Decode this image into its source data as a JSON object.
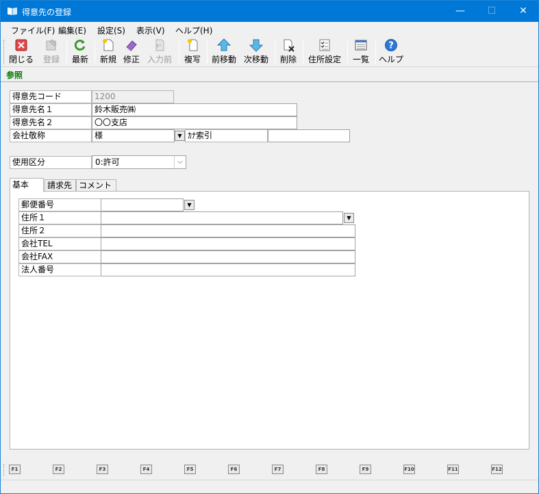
{
  "window": {
    "title": "得意先の登録",
    "minimize": "—",
    "maximize": "☐",
    "close": "✕"
  },
  "menu": [
    "ファイル(F)",
    "編集(E)",
    "設定(S)",
    "表示(V)",
    "ヘルプ(H)"
  ],
  "toolbar": {
    "close": "閉じる",
    "register": "登録",
    "refresh": "最新",
    "new": "新規",
    "edit": "修正",
    "prev_input": "入力前",
    "copy": "複写",
    "prev_move": "前移動",
    "next_move": "次移動",
    "delete": "削除",
    "address_settings": "住所設定",
    "list": "一覧",
    "help": "ヘルプ"
  },
  "ref_tab": "参照",
  "form": {
    "code_label": "得意先コード",
    "code_value": "1200",
    "name1_label": "得意先名１",
    "name1_value": "鈴木販売㈱",
    "name2_label": "得意先名２",
    "name2_value": "〇〇支店",
    "honorific_label": "会社敬称",
    "honorific_value": "様",
    "kana_label": "ｶﾅ索引",
    "kana_value": "",
    "usage_label": "使用区分",
    "usage_value": "0:許可"
  },
  "tabs": [
    "基本",
    "請求先",
    "コメント"
  ],
  "basic": {
    "postal_label": "郵便番号",
    "postal_value": "",
    "address1_label": "住所１",
    "address1_value": "",
    "address2_label": "住所２",
    "address2_value": "",
    "tel_label": "会社TEL",
    "tel_value": "",
    "fax_label": "会社FAX",
    "fax_value": "",
    "corp_label": "法人番号",
    "corp_value": ""
  },
  "fkeys": [
    "F1",
    "F2",
    "F3",
    "F4",
    "F5",
    "F6",
    "F7",
    "F8",
    "F9",
    "F10",
    "F11",
    "F12"
  ]
}
